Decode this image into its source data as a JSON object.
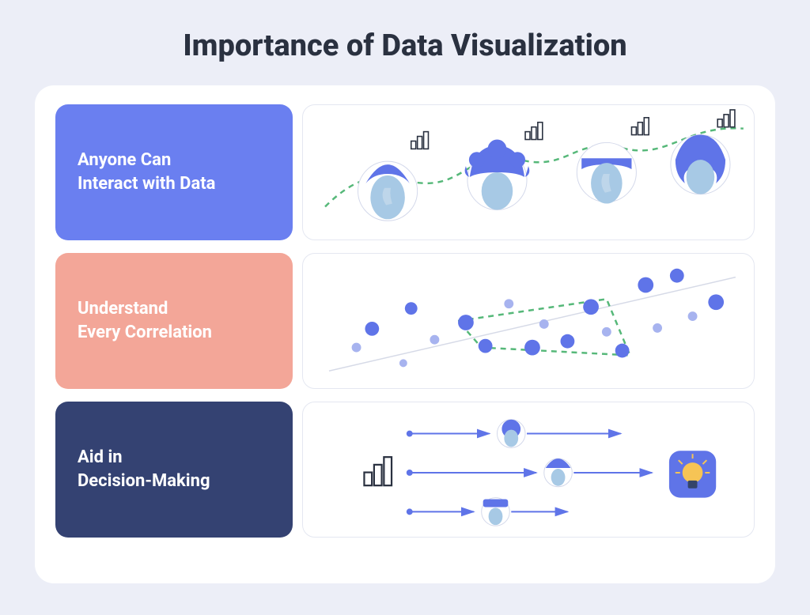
{
  "title": "Importance of Data Visualization",
  "rows": [
    {
      "label": "Anyone Can\nInteract with Data"
    },
    {
      "label": "Understand\nEvery Correlation"
    },
    {
      "label": "Aid in\nDecision-Making"
    }
  ],
  "colors": {
    "label_interact": "#6a7ff0",
    "label_correlation": "#f3a698",
    "label_decision": "#344272",
    "accent_green": "#56b879",
    "accent_blue": "#5f74e8"
  }
}
